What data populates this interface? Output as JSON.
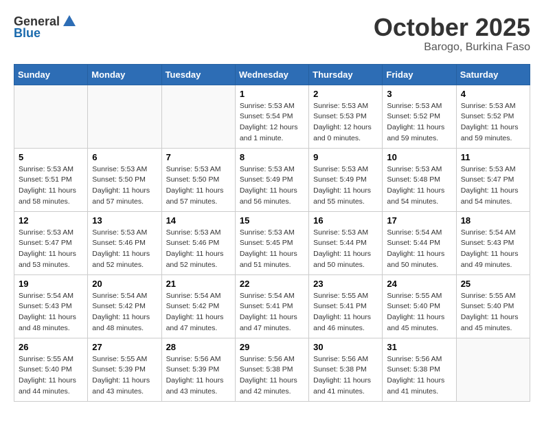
{
  "header": {
    "logo_general": "General",
    "logo_blue": "Blue",
    "month_title": "October 2025",
    "location": "Barogo, Burkina Faso"
  },
  "weekdays": [
    "Sunday",
    "Monday",
    "Tuesday",
    "Wednesday",
    "Thursday",
    "Friday",
    "Saturday"
  ],
  "weeks": [
    [
      {
        "day": "",
        "info": ""
      },
      {
        "day": "",
        "info": ""
      },
      {
        "day": "",
        "info": ""
      },
      {
        "day": "1",
        "info": "Sunrise: 5:53 AM\nSunset: 5:54 PM\nDaylight: 12 hours\nand 1 minute."
      },
      {
        "day": "2",
        "info": "Sunrise: 5:53 AM\nSunset: 5:53 PM\nDaylight: 12 hours\nand 0 minutes."
      },
      {
        "day": "3",
        "info": "Sunrise: 5:53 AM\nSunset: 5:52 PM\nDaylight: 11 hours\nand 59 minutes."
      },
      {
        "day": "4",
        "info": "Sunrise: 5:53 AM\nSunset: 5:52 PM\nDaylight: 11 hours\nand 59 minutes."
      }
    ],
    [
      {
        "day": "5",
        "info": "Sunrise: 5:53 AM\nSunset: 5:51 PM\nDaylight: 11 hours\nand 58 minutes."
      },
      {
        "day": "6",
        "info": "Sunrise: 5:53 AM\nSunset: 5:50 PM\nDaylight: 11 hours\nand 57 minutes."
      },
      {
        "day": "7",
        "info": "Sunrise: 5:53 AM\nSunset: 5:50 PM\nDaylight: 11 hours\nand 57 minutes."
      },
      {
        "day": "8",
        "info": "Sunrise: 5:53 AM\nSunset: 5:49 PM\nDaylight: 11 hours\nand 56 minutes."
      },
      {
        "day": "9",
        "info": "Sunrise: 5:53 AM\nSunset: 5:49 PM\nDaylight: 11 hours\nand 55 minutes."
      },
      {
        "day": "10",
        "info": "Sunrise: 5:53 AM\nSunset: 5:48 PM\nDaylight: 11 hours\nand 54 minutes."
      },
      {
        "day": "11",
        "info": "Sunrise: 5:53 AM\nSunset: 5:47 PM\nDaylight: 11 hours\nand 54 minutes."
      }
    ],
    [
      {
        "day": "12",
        "info": "Sunrise: 5:53 AM\nSunset: 5:47 PM\nDaylight: 11 hours\nand 53 minutes."
      },
      {
        "day": "13",
        "info": "Sunrise: 5:53 AM\nSunset: 5:46 PM\nDaylight: 11 hours\nand 52 minutes."
      },
      {
        "day": "14",
        "info": "Sunrise: 5:53 AM\nSunset: 5:46 PM\nDaylight: 11 hours\nand 52 minutes."
      },
      {
        "day": "15",
        "info": "Sunrise: 5:53 AM\nSunset: 5:45 PM\nDaylight: 11 hours\nand 51 minutes."
      },
      {
        "day": "16",
        "info": "Sunrise: 5:53 AM\nSunset: 5:44 PM\nDaylight: 11 hours\nand 50 minutes."
      },
      {
        "day": "17",
        "info": "Sunrise: 5:54 AM\nSunset: 5:44 PM\nDaylight: 11 hours\nand 50 minutes."
      },
      {
        "day": "18",
        "info": "Sunrise: 5:54 AM\nSunset: 5:43 PM\nDaylight: 11 hours\nand 49 minutes."
      }
    ],
    [
      {
        "day": "19",
        "info": "Sunrise: 5:54 AM\nSunset: 5:43 PM\nDaylight: 11 hours\nand 48 minutes."
      },
      {
        "day": "20",
        "info": "Sunrise: 5:54 AM\nSunset: 5:42 PM\nDaylight: 11 hours\nand 48 minutes."
      },
      {
        "day": "21",
        "info": "Sunrise: 5:54 AM\nSunset: 5:42 PM\nDaylight: 11 hours\nand 47 minutes."
      },
      {
        "day": "22",
        "info": "Sunrise: 5:54 AM\nSunset: 5:41 PM\nDaylight: 11 hours\nand 47 minutes."
      },
      {
        "day": "23",
        "info": "Sunrise: 5:55 AM\nSunset: 5:41 PM\nDaylight: 11 hours\nand 46 minutes."
      },
      {
        "day": "24",
        "info": "Sunrise: 5:55 AM\nSunset: 5:40 PM\nDaylight: 11 hours\nand 45 minutes."
      },
      {
        "day": "25",
        "info": "Sunrise: 5:55 AM\nSunset: 5:40 PM\nDaylight: 11 hours\nand 45 minutes."
      }
    ],
    [
      {
        "day": "26",
        "info": "Sunrise: 5:55 AM\nSunset: 5:40 PM\nDaylight: 11 hours\nand 44 minutes."
      },
      {
        "day": "27",
        "info": "Sunrise: 5:55 AM\nSunset: 5:39 PM\nDaylight: 11 hours\nand 43 minutes."
      },
      {
        "day": "28",
        "info": "Sunrise: 5:56 AM\nSunset: 5:39 PM\nDaylight: 11 hours\nand 43 minutes."
      },
      {
        "day": "29",
        "info": "Sunrise: 5:56 AM\nSunset: 5:38 PM\nDaylight: 11 hours\nand 42 minutes."
      },
      {
        "day": "30",
        "info": "Sunrise: 5:56 AM\nSunset: 5:38 PM\nDaylight: 11 hours\nand 41 minutes."
      },
      {
        "day": "31",
        "info": "Sunrise: 5:56 AM\nSunset: 5:38 PM\nDaylight: 11 hours\nand 41 minutes."
      },
      {
        "day": "",
        "info": ""
      }
    ]
  ]
}
